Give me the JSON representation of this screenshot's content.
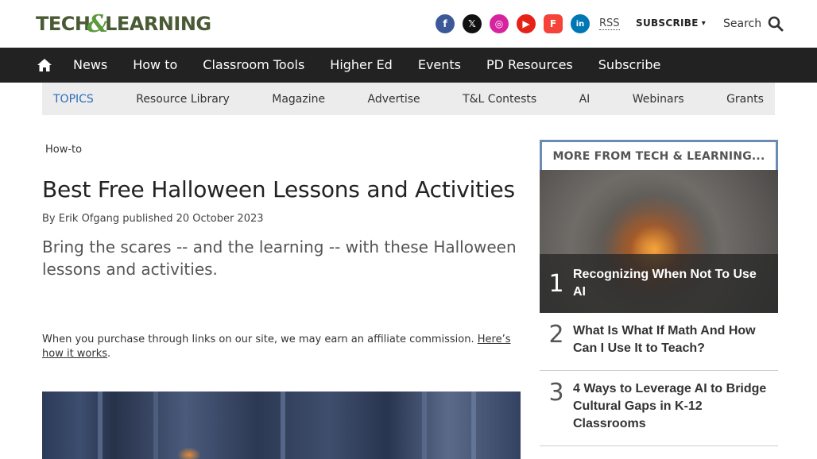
{
  "header": {
    "logo_text_1": "TECH",
    "logo_amp": "&",
    "logo_text_2": "LEARNING",
    "socials": [
      {
        "name": "facebook-icon",
        "glyph": "f"
      },
      {
        "name": "x-icon",
        "glyph": "𝕏"
      },
      {
        "name": "instagram-icon",
        "glyph": "◎"
      },
      {
        "name": "youtube-icon",
        "glyph": "▶"
      },
      {
        "name": "flipboard-icon",
        "glyph": "F"
      },
      {
        "name": "linkedin-icon",
        "glyph": "in"
      }
    ],
    "rss_label": "RSS",
    "subscribe_label": "SUBSCRIBE",
    "subscribe_caret": "▾",
    "search_label": "Search"
  },
  "nav": {
    "items": [
      "News",
      "How to",
      "Classroom Tools",
      "Higher Ed",
      "Events",
      "PD Resources",
      "Subscribe"
    ]
  },
  "topics": {
    "label": "TOPICS",
    "items": [
      "Resource Library",
      "Magazine",
      "Advertise",
      "T&L Contests",
      "AI",
      "Webinars",
      "Grants"
    ]
  },
  "article": {
    "breadcrumb": "How-to",
    "title": "Best Free Halloween Lessons and Activities",
    "byline": "By Erik Ofgang published 20 October 2023",
    "dek": "Bring the scares -- and the learning -- with these Halloween lessons and activities.",
    "affiliate_text": "When you purchase through links on our site, we may earn an affiliate commission. ",
    "affiliate_link": "Here’s how it works",
    "affiliate_end": "."
  },
  "sidebar": {
    "heading": "MORE FROM TECH & LEARNING...",
    "items": [
      {
        "num": "1",
        "title": "Recognizing When Not To Use AI"
      },
      {
        "num": "2",
        "title": "What Is What If Math And How Can I Use It to Teach?"
      },
      {
        "num": "3",
        "title": "4 Ways to Leverage AI to Bridge Cultural Gaps in K-12 Classrooms"
      }
    ]
  }
}
